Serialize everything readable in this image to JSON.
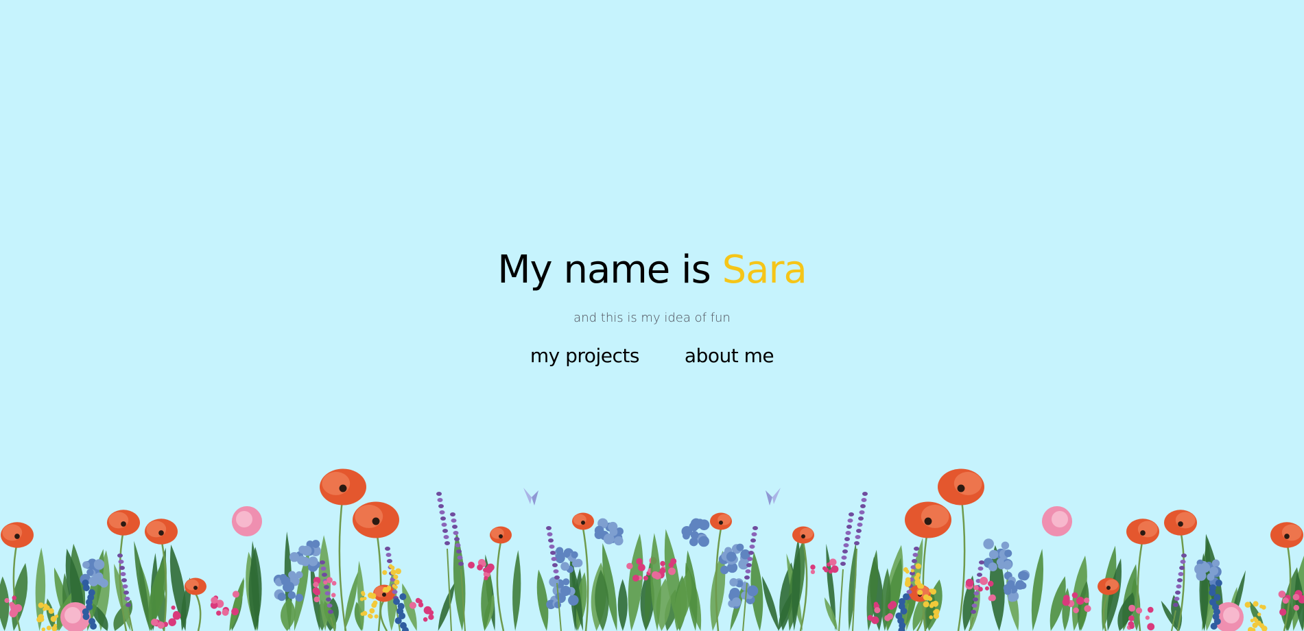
{
  "hero": {
    "headline_prefix": "My name is",
    "headline_name": "Sara",
    "tagline": "and this is my idea of fun"
  },
  "nav": {
    "projects_label": "my projects",
    "about_label": "about me"
  },
  "colors": {
    "background": "#c6f3fd",
    "accent_name": "#f5c518",
    "text": "#000000",
    "tagline": "#4a4a55"
  },
  "decoration": {
    "illustration": "wildflower-meadow",
    "flower_kinds": [
      "poppy",
      "peony",
      "hydrangea",
      "lavender",
      "foxglove",
      "daisy-cluster"
    ]
  }
}
